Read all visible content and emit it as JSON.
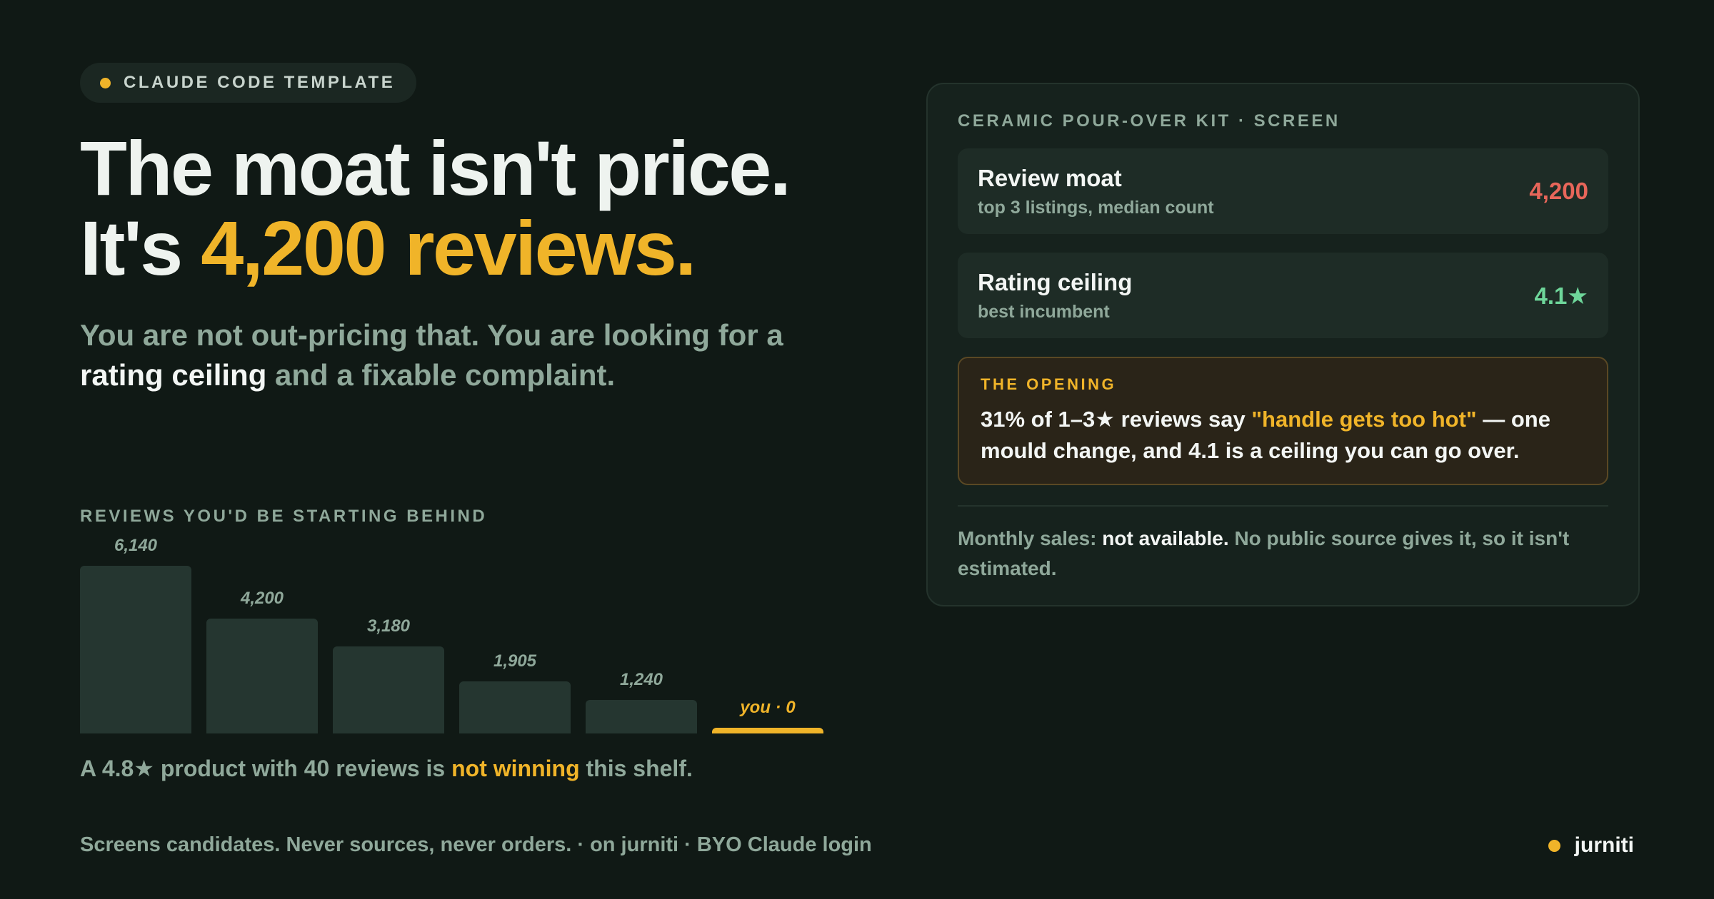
{
  "badge": {
    "label": "CLAUDE CODE TEMPLATE"
  },
  "headline": {
    "line1": "The moat isn't price.",
    "line2_prefix": "It's ",
    "line2_accent": "4,200 reviews."
  },
  "subhead": {
    "part1": "You are not out-pricing that. You are looking for a ",
    "emphasis": "rating ceiling",
    "part2": " and a fixable complaint."
  },
  "chart_data": {
    "type": "bar",
    "title": "REVIEWS YOU'D BE STARTING BEHIND",
    "categories": [
      "",
      "",
      "",
      "",
      "",
      "you"
    ],
    "values": [
      6140,
      4200,
      3180,
      1905,
      1240,
      0
    ],
    "labels": [
      "6,140",
      "4,200",
      "3,180",
      "1,905",
      "1,240",
      "you · 0"
    ],
    "ylim": [
      0,
      6140
    ],
    "grid": false,
    "colors": {
      "bar": "#253630",
      "highlight": "#f0b429"
    }
  },
  "caption": {
    "part1": "A 4.8★ product with 40 reviews is ",
    "warn": "not winning",
    "part2": " this shelf."
  },
  "footer": {
    "text": "Screens candidates. Never sources, never orders. · on jurniti · BYO Claude login",
    "brand": "jurniti"
  },
  "card": {
    "title": "CERAMIC POUR-OVER KIT · SCREEN",
    "metrics": [
      {
        "name": "Review moat",
        "sub": "top 3 listings, median count",
        "value": "4,200",
        "color": "#e8665a"
      },
      {
        "name": "Rating ceiling",
        "sub": "best incumbent",
        "value": "4.1★",
        "color": "#6ed69a"
      }
    ],
    "opening": {
      "label": "THE OPENING",
      "text_before": "31% of 1–3★ reviews say ",
      "quote": "\"handle gets too hot\"",
      "text_after": " — one mould change, and 4.1 is a ceiling you can go over."
    },
    "note": {
      "prefix": "Monthly sales: ",
      "emphasis": "not available.",
      "suffix": " No public source gives it, so it isn't estimated."
    }
  },
  "colors": {
    "accent": "#f0b429",
    "background": "#101915"
  }
}
